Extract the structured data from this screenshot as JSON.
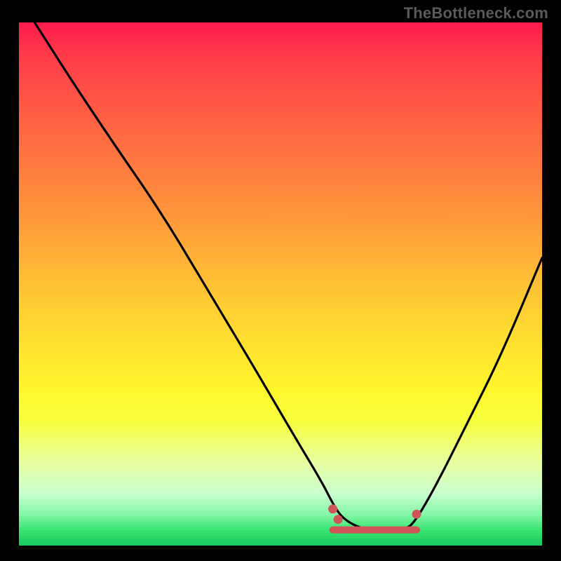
{
  "watermark": "TheBottleneck.com",
  "chart_data": {
    "type": "line",
    "title": "",
    "xlabel": "",
    "ylabel": "",
    "xlim": [
      0,
      100
    ],
    "ylim": [
      0,
      100
    ],
    "grid": false,
    "legend": false,
    "series": [
      {
        "name": "curve",
        "x": [
          3,
          10,
          18,
          27,
          36,
          45,
          52,
          58,
          60,
          62,
          66,
          70,
          74,
          76,
          80,
          86,
          92,
          100
        ],
        "y": [
          100,
          89,
          77,
          64,
          49,
          34,
          22,
          12,
          8,
          5,
          3,
          3,
          3,
          5,
          12,
          24,
          36,
          55
        ]
      }
    ],
    "flat_segment": {
      "x_start": 60,
      "x_end": 76,
      "y": 3
    },
    "markers": [
      {
        "x": 60,
        "y": 7
      },
      {
        "x": 61,
        "y": 5
      },
      {
        "x": 76,
        "y": 6
      }
    ],
    "colors": {
      "curve": "#000000",
      "marker": "#cf5658",
      "gradient_top": "#ff1a4d",
      "gradient_bottom": "#18c95c",
      "background": "#000000"
    }
  }
}
